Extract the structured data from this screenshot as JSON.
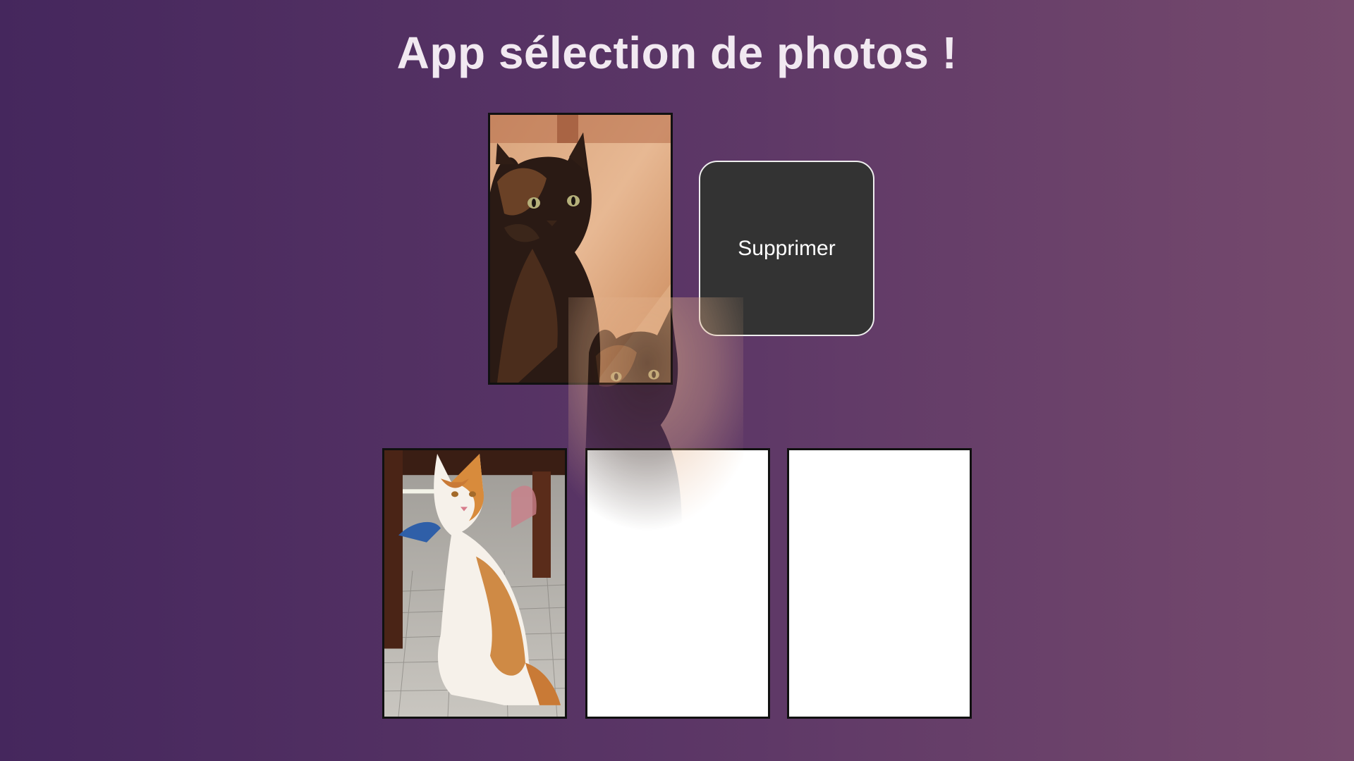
{
  "app": {
    "title": "App sélection de photos !"
  },
  "preview": {
    "photo": "dark-tortoiseshell-cat-photo"
  },
  "actions": {
    "delete_label": "Supprimer"
  },
  "slots": [
    {
      "state": "filled",
      "photo": "orange-white-cat-photo"
    },
    {
      "state": "empty"
    },
    {
      "state": "empty"
    }
  ],
  "drag": {
    "dragging": true,
    "photo": "dark-tortoiseshell-cat-photo"
  },
  "colors": {
    "background_start": "#45275d",
    "background_end": "#764a6d",
    "title": "#f1e9f1",
    "button_bg": "#333333",
    "button_text": "#ffffff"
  }
}
